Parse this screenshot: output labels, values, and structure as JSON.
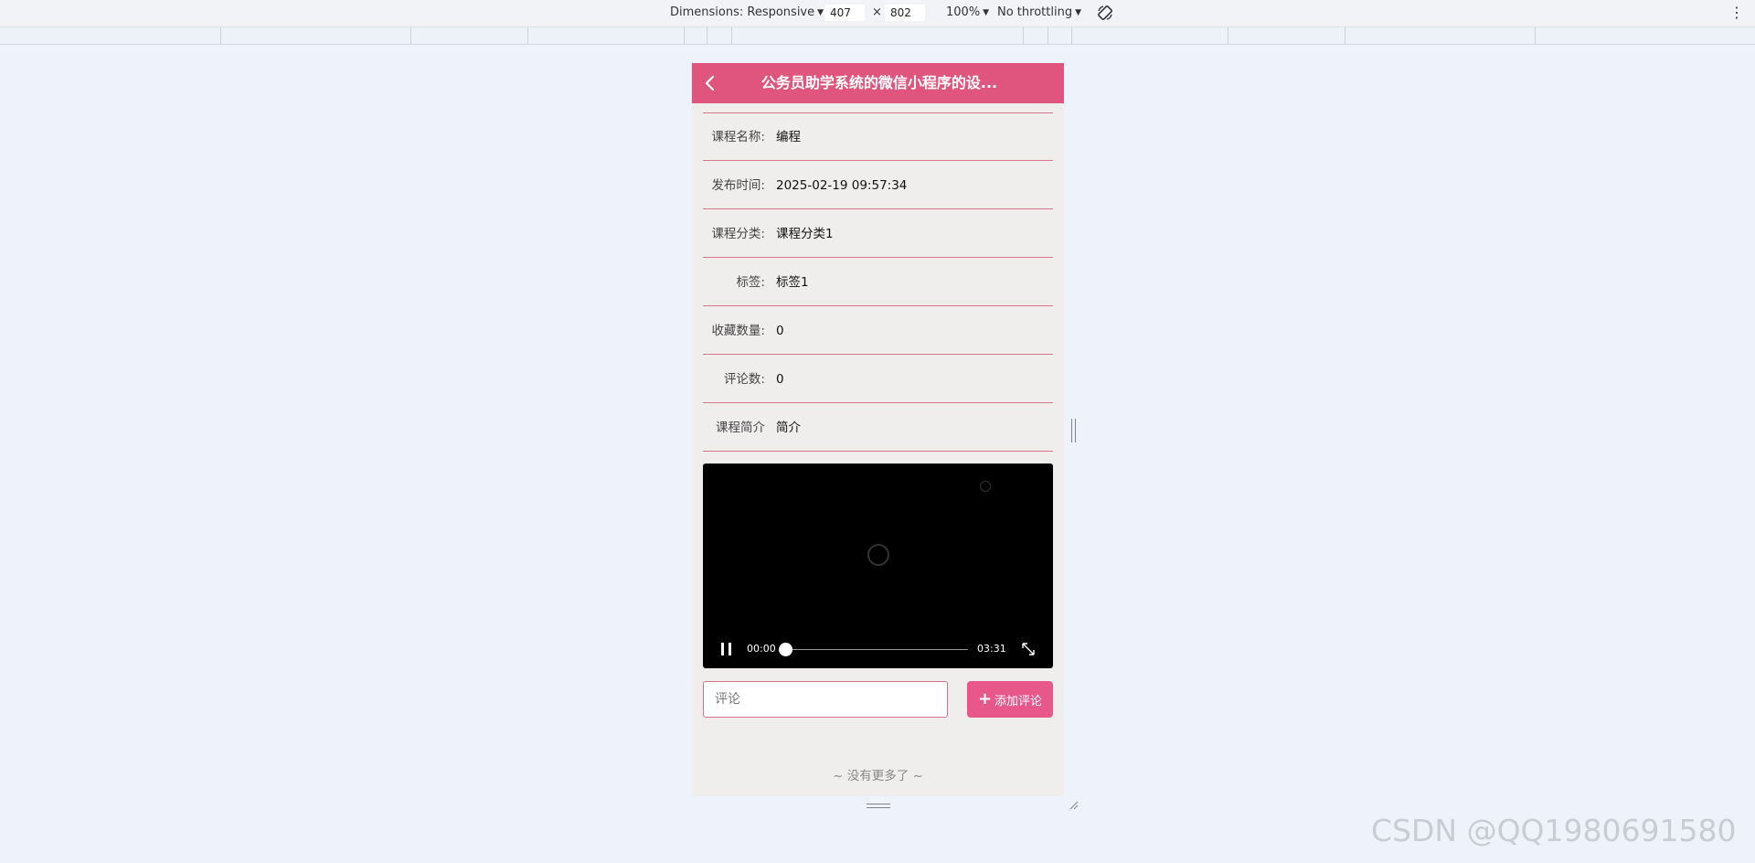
{
  "devtools": {
    "dimensions_label": "Dimensions: Responsive",
    "width": "407",
    "times": "×",
    "height": "802",
    "zoom": "100%",
    "throttling": "No throttling",
    "rotate_icon": "rotate-icon",
    "menu_icon": "more-vert-icon"
  },
  "app": {
    "title": "公务员助学系统的微信小程序的设...",
    "back_icon": "chevron-left-icon",
    "accent_color": "#e0557d",
    "fields": [
      {
        "label": "课程名称:",
        "value": "编程"
      },
      {
        "label": "发布时间:",
        "value": "2025-02-19 09:57:34"
      },
      {
        "label": "课程分类:",
        "value": "课程分类1"
      },
      {
        "label": "标签:",
        "value": "标签1"
      },
      {
        "label": "收藏数量:",
        "value": "0"
      },
      {
        "label": "评论数:",
        "value": "0"
      },
      {
        "label": "课程简介",
        "value": "简介"
      }
    ],
    "video": {
      "current_time": "00:00",
      "duration": "03:31",
      "progress": 0,
      "play_state_icon": "pause-icon",
      "fullscreen_icon": "fullscreen-icon"
    },
    "comment": {
      "placeholder": "评论",
      "button_label": "添加评论",
      "button_icon": "plus-icon"
    },
    "no_more": "~ 没有更多了 ~"
  },
  "watermark": "CSDN @QQ1980691580"
}
